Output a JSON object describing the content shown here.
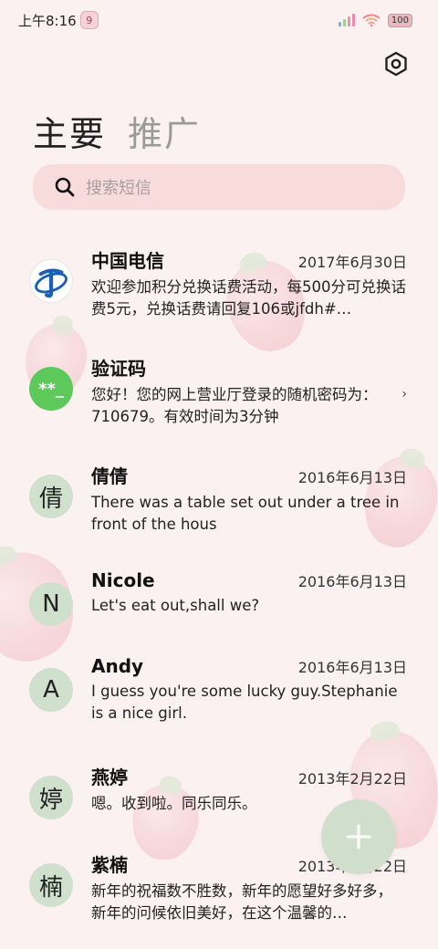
{
  "status_bar": {
    "time": "上午8:16",
    "app_badge": "9",
    "battery": "100"
  },
  "tabs": [
    {
      "label": "主要",
      "active": true
    },
    {
      "label": "推广",
      "active": false
    }
  ],
  "search": {
    "placeholder": "搜索短信"
  },
  "conversations": [
    {
      "name": "中国电信",
      "date": "2017年6月30日",
      "preview": "欢迎参加积分兑换话费活动，每500分可兑换话费5元，兑换话费请回复106或jfdh#…",
      "avatar": "china-telecom-logo"
    },
    {
      "name": "验证码",
      "date": "",
      "preview": "您好！您的网上营业厅登录的随机密码为：710679。有效时间为3分钟",
      "avatar": "**_"
    },
    {
      "name": "倩倩",
      "date": "2016年6月13日",
      "preview": "There was a table set out under a tree in front of the hous",
      "avatar": "倩"
    },
    {
      "name": "Nicole",
      "date": "2016年6月13日",
      "preview": "Let's eat out,shall we?",
      "avatar": "N"
    },
    {
      "name": "Andy",
      "date": "2016年6月13日",
      "preview": "I guess you're some lucky guy.Stephanie is a nice girl.",
      "avatar": "A"
    },
    {
      "name": "燕婷",
      "date": "2013年2月22日",
      "preview": "嗯。收到啦。同乐同乐。",
      "avatar": "婷"
    },
    {
      "name": "紫楠",
      "date": "2013年2月22日",
      "preview": "新年的祝福数不胜数，新年的愿望好多好多，新年的问候依旧美好，在这个温馨的…",
      "avatar": "楠"
    }
  ],
  "colors": {
    "background": "#fbf1f1",
    "search_bg": "#f8dcdc",
    "avatar_bg": "#cfe0cc",
    "code_avatar": "#5cc95a",
    "fab": "#cfdfcc"
  },
  "icons": {
    "settings": "gear-hexagon-icon",
    "search": "search-icon",
    "fab": "plus-icon"
  }
}
